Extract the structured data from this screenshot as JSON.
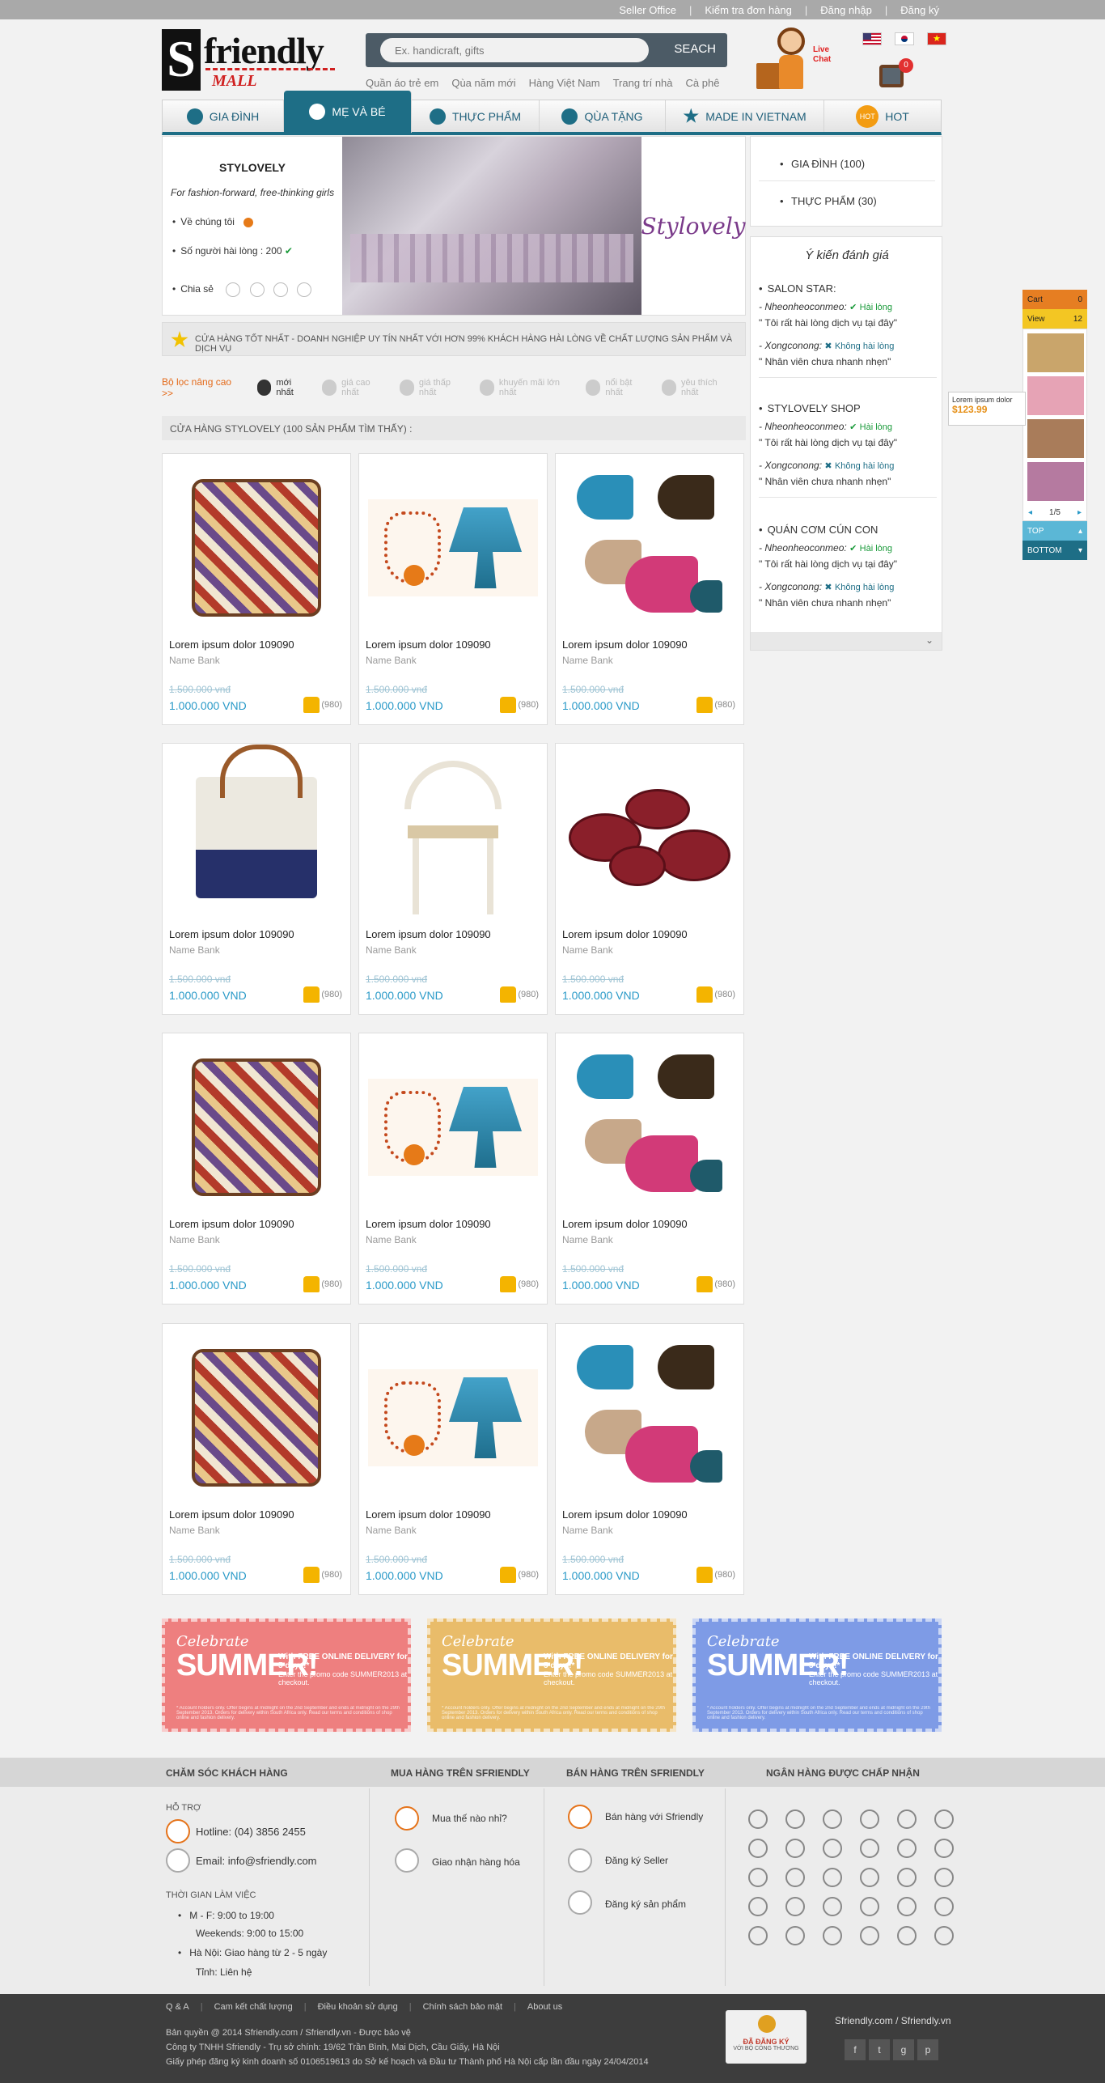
{
  "topbar": {
    "links": [
      "Seller Office",
      "Kiểm tra đơn hàng",
      "Đăng nhập",
      "Đăng ký"
    ]
  },
  "logo": {
    "letter": "S",
    "word": "friendly",
    "sub": "MALL"
  },
  "search": {
    "placeholder": "Ex. handicraft, gifts",
    "button": "SEACH"
  },
  "quick_links": [
    "Quần áo trẻ em",
    "Qùa năm mới",
    "Hàng Việt Nam",
    "Trang trí nhà",
    "Cà phê"
  ],
  "livechat": {
    "label_line1": "Live",
    "label_line2": "Chat"
  },
  "cart_count": "0",
  "nav": [
    {
      "label": "GIA ĐÌNH",
      "icon": "family-icon"
    },
    {
      "label": "MẸ VÀ BÉ",
      "icon": "mother-baby-icon"
    },
    {
      "label": "THỰC PHẨM",
      "icon": "food-icon"
    },
    {
      "label": "QÙA TẶNG",
      "icon": "gift-icon"
    },
    {
      "label": "MADE IN VIETNAM",
      "icon": "star-icon"
    },
    {
      "label": "HOT",
      "icon": "hot-badge-icon"
    }
  ],
  "store": {
    "name": "STYLOVELY",
    "tagline": "For fashion-forward, free-thinking girls",
    "about": "Về chúng tôi",
    "satisfied_label": "Số người hài lòng :",
    "satisfied_count": "200",
    "share": "Chia sẻ",
    "brand_script": "Stylovely"
  },
  "categories": [
    "GIA ĐÌNH (100)",
    "THỰC PHẨM (30)"
  ],
  "opinions": {
    "title": "Ý kiến đánh giá",
    "shops": [
      {
        "shop": "SALON STAR:",
        "u1": "- Nheonheoconmeo:",
        "s1": "Hài lòng",
        "q1": "\" Tôi rất hài lòng dịch vụ tại đây\"",
        "u2": "- Xongconong:",
        "s2": "Không hài lòng",
        "q2": "\" Nhân viên chưa nhanh nhẹn\""
      },
      {
        "shop": "STYLOVELY SHOP",
        "u1": "- Nheonheoconmeo:",
        "s1": "Hài lòng",
        "q1": "\" Tôi rất hài lòng dịch vụ tại đây\"",
        "u2": "- Xongconong:",
        "s2": "Không hài lòng",
        "q2": "\" Nhân viên chưa nhanh nhẹn\""
      },
      {
        "shop": "QUÁN CƠM CÚN CON",
        "u1": "- Nheonheoconmeo:",
        "s1": "Hài lòng",
        "q1": "\" Tôi rất hài lòng dịch vụ tại đây\"",
        "u2": "- Xongconong:",
        "s2": "Không hài lòng",
        "q2": "\" Nhân viên chưa nhanh nhẹn\""
      }
    ]
  },
  "notice": "CỬA HÀNG TỐT NHẤT - DOANH NGHIỆP UY TÍN NHẤT VỚI HƠN 99% KHÁCH HÀNG HÀI LÒNG VỀ CHẤT LƯỢNG SẢN PHẨM VÀ DỊCH VỤ",
  "filters": {
    "label": "Bộ lọc nâng cao  >>",
    "items": [
      "mới nhất",
      "giá cao nhất",
      "giá thấp nhất",
      "khuyến mãi lớn nhất",
      "nổi bật nhất",
      "yêu thích nhất"
    ]
  },
  "results": "CỬA HÀNG STYLOVELY (100 SẢN PHẨM TÌM THẤY) :",
  "product": {
    "name": "Lorem ipsum dolor 109090",
    "brand": "Name Bank",
    "old_price": "1.500.000 vnđ",
    "price": "1.000.000 VND",
    "likes": "(980)"
  },
  "banner": {
    "celebrate": "Celebrate",
    "summer": "SUMMER!",
    "d1": "With FREE ONLINE DELIVERY for 5 days!*",
    "d2": "Enter the promo code SUMMER2013 at checkout.",
    "fine": "* Account holders only. Offer begins at midnight on the 2nd September and ends at midnight on the 29th September 2013. Orders for delivery within South Africa only. Read our terms and conditions of shop online and fashion delivery."
  },
  "footer": {
    "titles": [
      "CHĂM SÓC KHÁCH HÀNG",
      "MUA HÀNG TRÊN SFRIENDLY",
      "BÁN HÀNG TRÊN SFRIENDLY",
      "NGÂN HÀNG ĐƯỢC CHẤP NHẬN"
    ],
    "support": "HỖ TRỢ",
    "hotline": "Hotline:  (04) 3856 2455",
    "email": "Email: info@sfriendly.com",
    "hours_title": "THỜI GIAN LÀM VIỆC",
    "hours1": "M - F: 9:00 to 19:00",
    "hours2": "Weekends: 9:00 to 15:00",
    "ship1": "Hà Nội: Giao hàng từ 2 - 5 ngày",
    "ship2": "Tỉnh: Liên hệ",
    "buy": [
      "Mua thế nào nhỉ?",
      "Giao nhận hàng hóa"
    ],
    "sell": [
      "Bán hàng với Sfriendly",
      "Đăng ký Seller",
      "Đăng ký sản phẩm"
    ]
  },
  "bottom": {
    "menu": [
      "Q & A",
      "Cam kết chất lượng",
      "Điều khoản sử dụng",
      "Chính sách bảo mật",
      "About us"
    ],
    "copy1": "Bản quyền @ 2014 Sfriendly.com / Sfriendly.vn - Được bảo vệ",
    "copy2": "Công ty TNHH Sfriendly - Trụ sở chính: 19/62 Trần Bình, Mai Dịch, Cầu Giấy, Hà Nội",
    "copy3": "Giấy phép đăng ký kinh doanh số 0106519613 do Sở kế hoạch và Đầu tư Thành phố Hà Nội cấp lần đầu ngày 24/04/2014",
    "cert": "ĐÃ ĐĂNG KÝ",
    "cert_sub": "VỚI BỘ CÔNG THƯƠNG",
    "domain": "Sfriendly.com / Sfriendly.vn"
  },
  "floating_cart": {
    "cart": "Cart",
    "cart_count": "0",
    "view": "View",
    "view_count": "12",
    "page": "1/5",
    "top": "TOP",
    "bottom": "BOTTOM"
  },
  "tooltip": {
    "name": "Lorem ipsum dolor",
    "price": "$123.99"
  }
}
